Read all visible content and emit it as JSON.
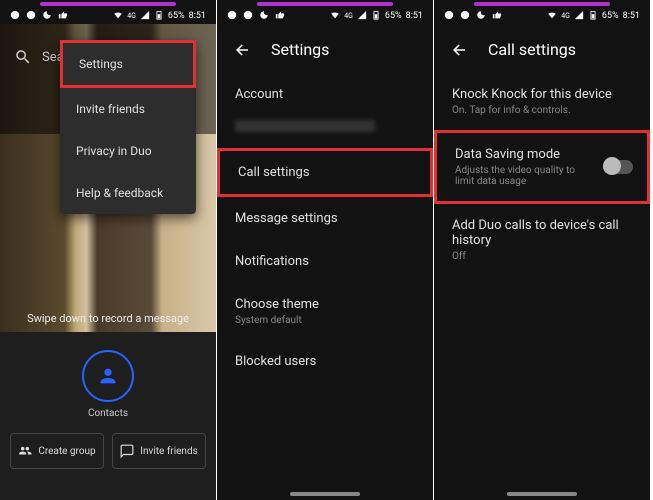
{
  "status": {
    "signal": "4G",
    "battery_pct": "65%",
    "time": "8:51"
  },
  "p1": {
    "search_placeholder": "Search co",
    "menu": {
      "settings": "Settings",
      "invite": "Invite friends",
      "privacy": "Privacy in Duo",
      "help": "Help & feedback"
    },
    "swipe": "Swipe down to record a message",
    "contacts": "Contacts",
    "create_group": "Create group",
    "invite_friends": "Invite friends"
  },
  "p2": {
    "title": "Settings",
    "account": "Account",
    "call_settings": "Call settings",
    "message_settings": "Message settings",
    "notifications": "Notifications",
    "choose_theme": "Choose theme",
    "choose_theme_sub": "System default",
    "blocked": "Blocked users"
  },
  "p3": {
    "title": "Call settings",
    "knock": "Knock Knock for this device",
    "knock_sub": "On. Tap for info & controls.",
    "data_saving": "Data Saving mode",
    "data_saving_sub": "Adjusts the video quality to limit data usage",
    "history": "Add Duo calls to device's call history",
    "history_sub": "Off"
  }
}
